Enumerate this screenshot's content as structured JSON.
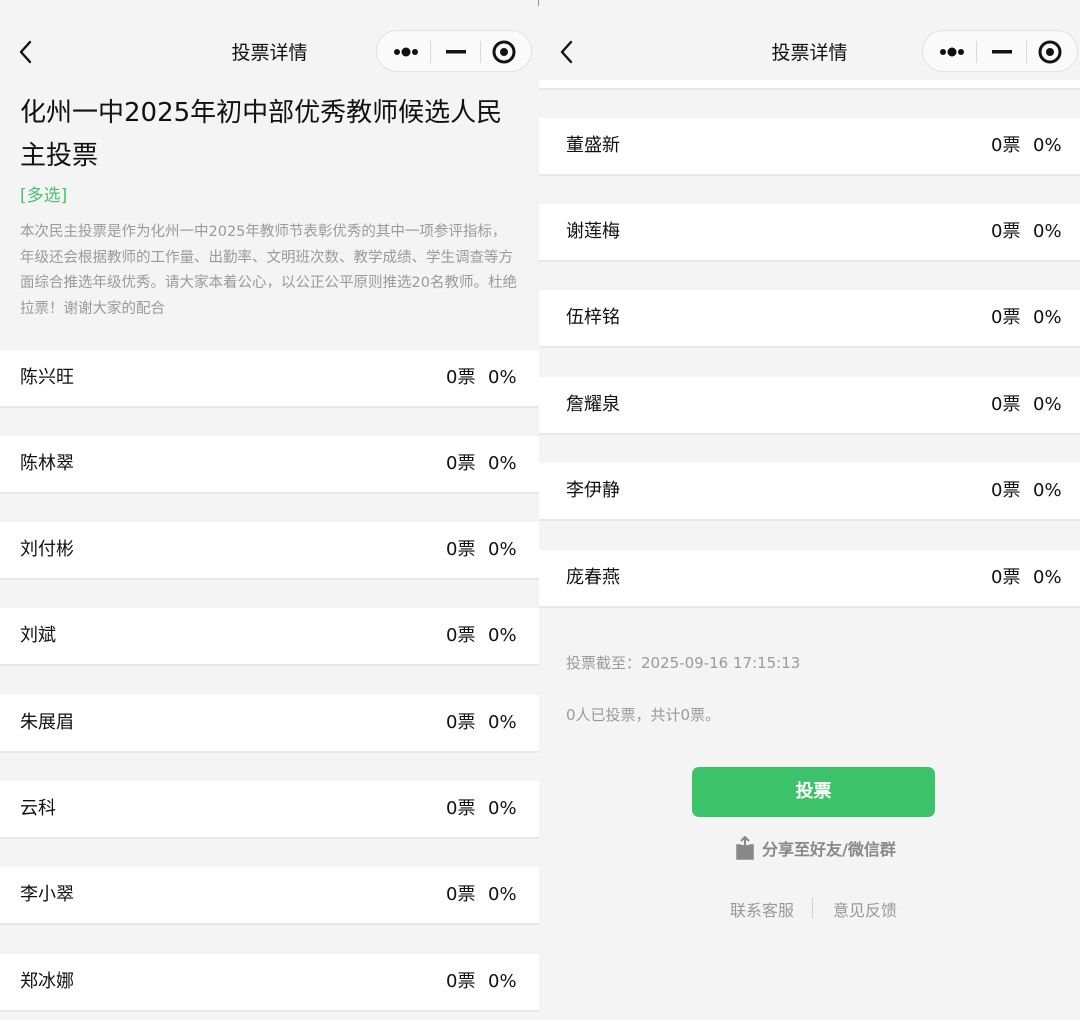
{
  "left": {
    "nav_title": "投票详情",
    "vote_title": "化州一中2025年初中部优秀教师候选人民主投票",
    "tag": "[多选]",
    "description": "本次民主投票是作为化州一中2025年教师节表彰优秀的其中一项参评指标，年级还会根据教师的工作量、出勤率、文明班次数、教学成绩、学生调查等方面综合推选年级优秀。请大家本着公心，以公正公平原则推选20名教师。杜绝拉票！谢谢大家的配合",
    "candidates": [
      {
        "name": "陈兴旺",
        "votes": "0票",
        "percent": "0%"
      },
      {
        "name": "陈林翠",
        "votes": "0票",
        "percent": "0%"
      },
      {
        "name": "刘付彬",
        "votes": "0票",
        "percent": "0%"
      },
      {
        "name": "刘斌",
        "votes": "0票",
        "percent": "0%"
      },
      {
        "name": "朱展眉",
        "votes": "0票",
        "percent": "0%"
      },
      {
        "name": "云科",
        "votes": "0票",
        "percent": "0%"
      },
      {
        "name": "李小翠",
        "votes": "0票",
        "percent": "0%"
      },
      {
        "name": "郑冰娜",
        "votes": "0票",
        "percent": "0%"
      }
    ]
  },
  "right": {
    "nav_title": "投票详情",
    "candidates": [
      {
        "name": "董盛新",
        "votes": "0票",
        "percent": "0%"
      },
      {
        "name": "谢莲梅",
        "votes": "0票",
        "percent": "0%"
      },
      {
        "name": "伍梓铭",
        "votes": "0票",
        "percent": "0%"
      },
      {
        "name": "詹耀泉",
        "votes": "0票",
        "percent": "0%"
      },
      {
        "name": "李伊静",
        "votes": "0票",
        "percent": "0%"
      },
      {
        "name": "庞春燕",
        "votes": "0票",
        "percent": "0%"
      }
    ],
    "deadline": "投票截至：2025-09-16 17:15:13",
    "summary": "0人已投票，共计0票。",
    "vote_button": "投票",
    "share_label": "分享至好友/微信群",
    "footer": {
      "contact": "联系客服",
      "feedback": "意见反馈"
    }
  },
  "colors": {
    "accent": "#3cc36a",
    "tag": "#4cc06e",
    "muted": "#9a9a9a"
  },
  "icons": {
    "back": "chevron-left-icon",
    "more": "more-dots-icon",
    "minimize": "minimize-icon",
    "close": "target-close-icon",
    "share": "share-icon"
  }
}
